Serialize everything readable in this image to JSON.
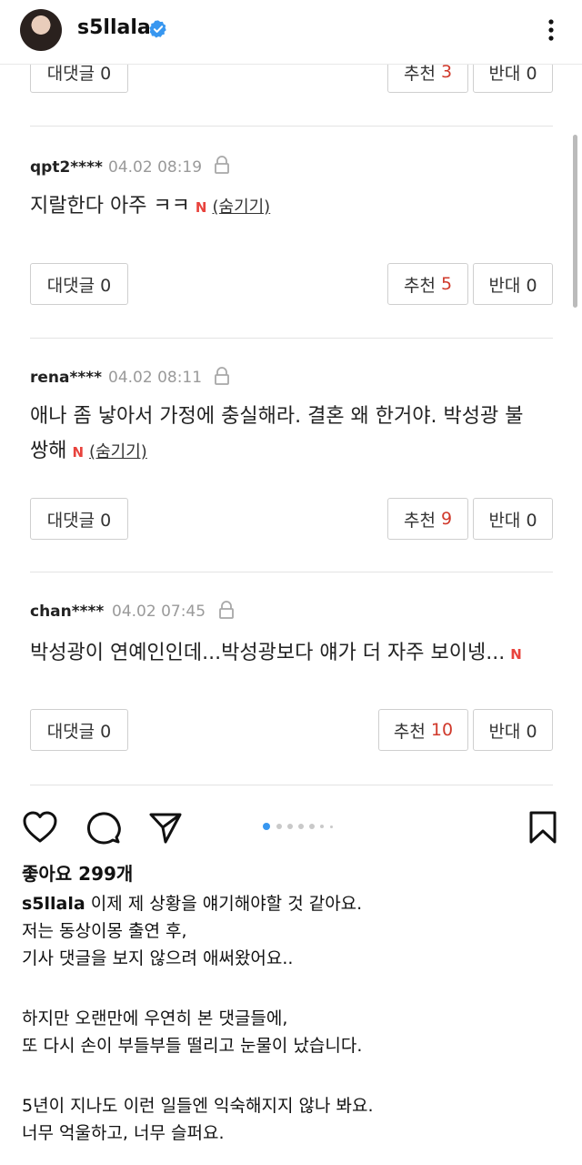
{
  "header": {
    "username": "s5llala",
    "verified_icon": "verified-badge-icon",
    "more_icon": "more-vertical-icon"
  },
  "comments": {
    "top_row": {
      "reply_label": "대댓글 0",
      "like_label": "추천",
      "like_count": "3",
      "dislike_label": "반대 0"
    },
    "items": [
      {
        "user": "qpt2****",
        "date": "04.02 08:19",
        "text": "지랄한다 아주 ㅋㅋ",
        "text_line2": "",
        "badge": "N",
        "hide": "(숨기기)",
        "reply_label": "대댓글 0",
        "like_label": "추천",
        "like_count": "5",
        "dislike_label": "반대 0"
      },
      {
        "user": "rena****",
        "date": "04.02 08:11",
        "text": "애나 좀 낳아서 가정에 충실해라. 결혼 왜 한거야. 박성광 불",
        "text_line2": "쌍해",
        "badge": "N",
        "hide": "(숨기기)",
        "reply_label": "대댓글 0",
        "like_label": "추천",
        "like_count": "9",
        "dislike_label": "반대 0"
      },
      {
        "user": "chan****",
        "date": "04.02 07:45",
        "text": "박성광이 연예인인데...박성광보다 얘가 더 자주 보이넹...",
        "text_line2": "",
        "badge": "N",
        "hide": "",
        "reply_label": "대댓글 0",
        "like_label": "추천",
        "like_count": "10",
        "dislike_label": "반대 0"
      }
    ]
  },
  "actions": {
    "like_icon": "heart-icon",
    "comment_icon": "comment-icon",
    "share_icon": "send-icon",
    "save_icon": "bookmark-icon",
    "carousel_total": 7,
    "carousel_active": 1
  },
  "post": {
    "likes": "좋아요 299개",
    "username": "s5llala",
    "caption_lines": [
      "이제 제 상황을 얘기해야할 것 같아요.",
      "저는 동상이몽 출연 후,",
      "기사 댓글을 보지 않으려 애써왔어요..",
      "",
      "하지만 오랜만에 우연히 본 댓글들에,",
      "또 다시 손이 부들부들 떨리고 눈물이 났습니다.",
      "",
      "5년이 지나도 이런 일들엔 익숙해지지 않나 봐요.",
      "너무 억울하고, 너무 슬퍼요."
    ]
  },
  "colors": {
    "accent_red": "#d0392b",
    "badge_red": "#e8433d",
    "carousel_active": "#3897f0",
    "verified_blue": "#3897f0"
  }
}
